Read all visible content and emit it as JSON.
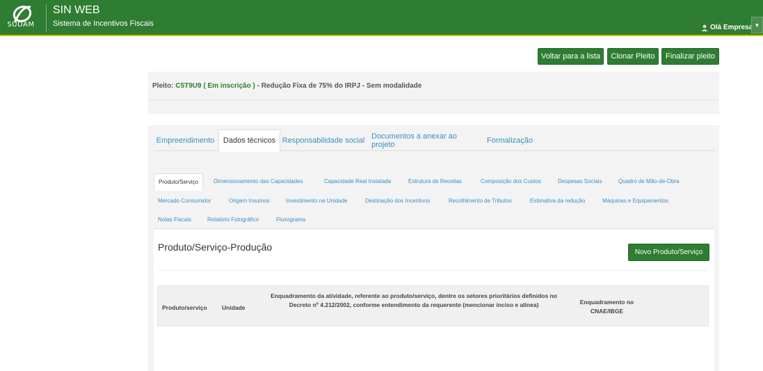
{
  "header": {
    "logo_text": "SUDAM",
    "app_title": "SIN WEB",
    "app_subtitle": "Sistema de Incentivos Fiscais",
    "user_greeting": "Olá Empresa",
    "brand_color": "#2e7d32"
  },
  "actions": {
    "voltar_label": "Voltar para a lista",
    "clonar_label": "Clonar Pleito",
    "finalizar_label": "Finalizar pleito"
  },
  "pleito": {
    "prefix": "Pleito: ",
    "code": "C5T9U9 ( Em inscrição )",
    "description": " - Redução Fixa de 75% do IRPJ - Sem modalidade"
  },
  "main_tabs": [
    {
      "label": "Empreendimento"
    },
    {
      "label": "Dados técnicos"
    },
    {
      "label": "Responsabilidade social"
    },
    {
      "label": "Documentos a anexar ao projeto"
    },
    {
      "label": "Formalização"
    }
  ],
  "sub_tabs": [
    {
      "label": "Produto/Serviço"
    },
    {
      "label": "Dimensionamento das Capacidades"
    },
    {
      "label": "Capacidade Real Instalada"
    },
    {
      "label": "Estrutura de Receitas"
    },
    {
      "label": "Composição dos Custos"
    },
    {
      "label": "Despesas Sociais"
    },
    {
      "label": "Quadro de Mão-de-Obra"
    },
    {
      "label": "Mercado Consumidor"
    },
    {
      "label": "Origem Insumos"
    },
    {
      "label": "Investimento na Unidade"
    },
    {
      "label": "Destinação dos Incentivos"
    },
    {
      "label": "Recolhimento de Tributos"
    },
    {
      "label": "Estimativa da redução"
    },
    {
      "label": "Máquinas e Equipamentos"
    },
    {
      "label": "Notas Fiscais"
    },
    {
      "label": "Relatório Fotográfico"
    },
    {
      "label": "Fluxograma"
    }
  ],
  "section": {
    "title": "Produto/Serviço-Produção",
    "new_button": "Novo Produto/Serviço"
  },
  "table": {
    "columns": [
      "Produto/serviço",
      "Unidade",
      "Enquadramento da atividade, referente ao produto/serviço, dentre os setores prioritários definidos no Decreto nº 4.212/2002, conforme entendimento da requerente (mencionar inciso e alínea)",
      "Enquadramento no CNAE/IBGE"
    ]
  }
}
